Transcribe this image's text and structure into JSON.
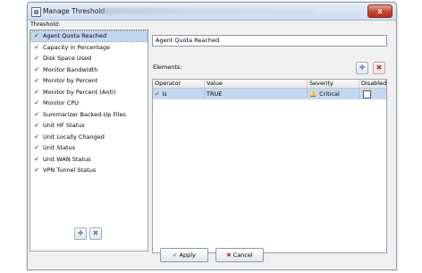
{
  "window": {
    "title": "Manage Threshold",
    "close_label": "x"
  },
  "threshold_label": "Threshold:",
  "thresholds": [
    {
      "label": "Agent Quota Reached",
      "selected": true
    },
    {
      "label": "Capacity in Percentage"
    },
    {
      "label": "Disk Space Used"
    },
    {
      "label": "Monitor Bandwidth"
    },
    {
      "label": "Monitor by Percent"
    },
    {
      "label": "Monitor by Percent (Anti)"
    },
    {
      "label": "Monitor CPU"
    },
    {
      "label": "Summarizer Backed-Up Files"
    },
    {
      "label": "Unit HF Status"
    },
    {
      "label": "Unit Locally Changed"
    },
    {
      "label": "Unit Status"
    },
    {
      "label": "Unit WAN Status"
    },
    {
      "label": "VPN Tunnel Status"
    }
  ],
  "name_value": "Agent Quota Reached",
  "elements_label": "Elements:",
  "table": {
    "headers": {
      "operator": "Operator",
      "value": "Value",
      "severity": "Severity",
      "disabled": "Disabled"
    },
    "rows": [
      {
        "operator": "is",
        "value": "TRUE",
        "severity": "Critical",
        "disabled": false
      }
    ]
  },
  "buttons": {
    "apply": "Apply",
    "cancel": "Cancel"
  },
  "icons": {
    "check": "check-icon",
    "add": "plus-icon",
    "delete": "x-icon",
    "bell": "bell-icon"
  },
  "colors": {
    "selection": "#c3d7f0",
    "check_green": "#3a9c2a",
    "critical_red": "#d84a2a",
    "close_red": "#c8452b"
  }
}
